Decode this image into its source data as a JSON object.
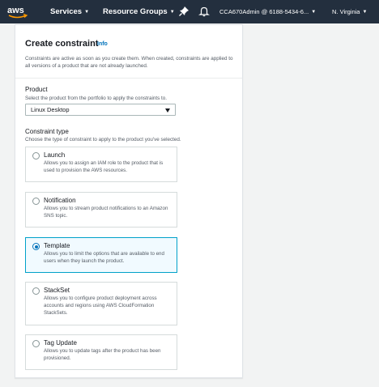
{
  "nav": {
    "logo_text": "aws",
    "services": "Services",
    "resource_groups": "Resource Groups",
    "account": "CCA670Admin @ 6188-5434-6...",
    "region": "N. Virginia"
  },
  "panel": {
    "title": "Create constraint",
    "info": "Info",
    "description": "Constraints are active as soon as you create them. When created, constraints are applied to all versions of a product that are not already launched."
  },
  "product": {
    "label": "Product",
    "hint": "Select the product from the portfolio to apply the constraints to.",
    "selected": "Linux Desktop"
  },
  "constraint_type": {
    "label": "Constraint type",
    "hint": "Choose the type of constraint to apply to the product you've selected.",
    "options": [
      {
        "title": "Launch",
        "desc": "Allows you to assign an IAM role to the product that is used to provision the AWS resources."
      },
      {
        "title": "Notification",
        "desc": "Allows you to stream product notifications to an Amazon SNS topic."
      },
      {
        "title": "Template",
        "desc": "Allows you to limit the options that are available to end users when they launch the product."
      },
      {
        "title": "StackSet",
        "desc": "Allows you to configure product deployment across accounts and regions using AWS CloudFormation StackSets."
      },
      {
        "title": "Tag Update",
        "desc": "Allows you to update tags after the product has been provisioned."
      }
    ],
    "selected": "Template"
  },
  "colors": {
    "nav_bg": "#232f3e",
    "accent": "#0073bb",
    "selected_border": "#00a1c9",
    "logo_smile": "#ff9900"
  }
}
